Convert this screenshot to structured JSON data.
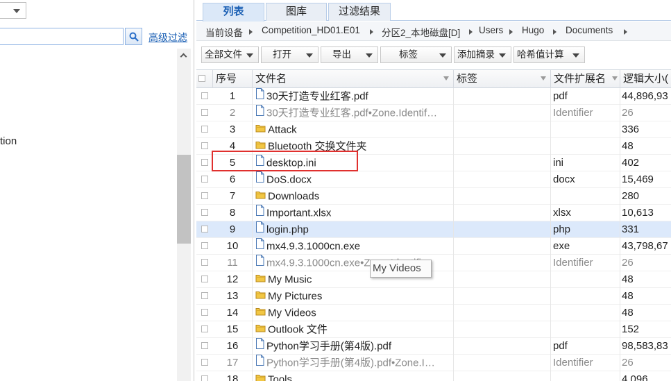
{
  "left_panel": {
    "advanced_filter_label": "高级过滤",
    "tree_fragment": "tion"
  },
  "tabs": [
    {
      "label": "列表",
      "active": true
    },
    {
      "label": "图库",
      "active": false
    },
    {
      "label": "过滤结果",
      "active": false
    }
  ],
  "breadcrumb": [
    "当前设备",
    "Competition_HD01.E01",
    "分区2_本地磁盘[D]",
    "Users",
    "Hugo",
    "Documents"
  ],
  "toolbar": {
    "all_files": "全部文件",
    "open": "打开",
    "export": "导出",
    "tag": "标签",
    "add_digest": "添加摘录",
    "hash_calc": "哈希值计算"
  },
  "columns": {
    "seq": "序号",
    "name": "文件名",
    "tag": "标签",
    "ext": "文件扩展名",
    "size": "逻辑大小("
  },
  "rows": [
    {
      "seq": "1",
      "name": "30天打造专业红客.pdf",
      "icon": "file-icon",
      "ext": "pdf",
      "size": "44,896,93"
    },
    {
      "seq": "2",
      "name": "30天打造专业红客.pdf•Zone.Identif…",
      "icon": "file-icon",
      "ext": "Identifier",
      "size": "26",
      "ads": true
    },
    {
      "seq": "3",
      "name": "Attack",
      "icon": "folder-icon",
      "ext": "",
      "size": "336"
    },
    {
      "seq": "4",
      "name": "Bluetooth 交换文件夹",
      "icon": "folder-icon",
      "ext": "",
      "size": "48"
    },
    {
      "seq": "5",
      "name": "desktop.ini",
      "icon": "file-icon",
      "ext": "ini",
      "size": "402"
    },
    {
      "seq": "6",
      "name": "DoS.docx",
      "icon": "file-icon",
      "ext": "docx",
      "size": "15,469"
    },
    {
      "seq": "7",
      "name": "Downloads",
      "icon": "folder-icon",
      "ext": "",
      "size": "280"
    },
    {
      "seq": "8",
      "name": "Important.xlsx",
      "icon": "file-icon",
      "ext": "xlsx",
      "size": "10,613"
    },
    {
      "seq": "9",
      "name": "login.php",
      "icon": "file-icon",
      "ext": "php",
      "size": "331",
      "selected": true
    },
    {
      "seq": "10",
      "name": "mx4.9.3.1000cn.exe",
      "icon": "file-icon",
      "ext": "exe",
      "size": "43,798,67"
    },
    {
      "seq": "11",
      "name": "mx4.9.3.1000cn.exe•Zone.Identifier",
      "icon": "file-icon",
      "ext": "Identifier",
      "size": "26",
      "ads": true
    },
    {
      "seq": "12",
      "name": "My Music",
      "icon": "folder-icon",
      "ext": "",
      "size": "48"
    },
    {
      "seq": "13",
      "name": "My Pictures",
      "icon": "folder-icon",
      "ext": "",
      "size": "48"
    },
    {
      "seq": "14",
      "name": "My Videos",
      "icon": "folder-icon",
      "ext": "",
      "size": "48"
    },
    {
      "seq": "15",
      "name": "Outlook 文件",
      "icon": "folder-icon",
      "ext": "",
      "size": "152"
    },
    {
      "seq": "16",
      "name": "Python学习手册(第4版).pdf",
      "icon": "file-icon",
      "ext": "pdf",
      "size": "98,583,83"
    },
    {
      "seq": "17",
      "name": "Python学习手册(第4版).pdf•Zone.I…",
      "icon": "file-icon",
      "ext": "Identifier",
      "size": "26",
      "ads": true
    },
    {
      "seq": "18",
      "name": "Tools",
      "icon": "folder-icon",
      "ext": "",
      "size": "4,096"
    }
  ],
  "tooltip": "My Videos",
  "colors": {
    "accent": "#1a5fb4",
    "selection": "#dce9fb",
    "highlight_box": "#e0302e",
    "folder": "#f2c744"
  }
}
